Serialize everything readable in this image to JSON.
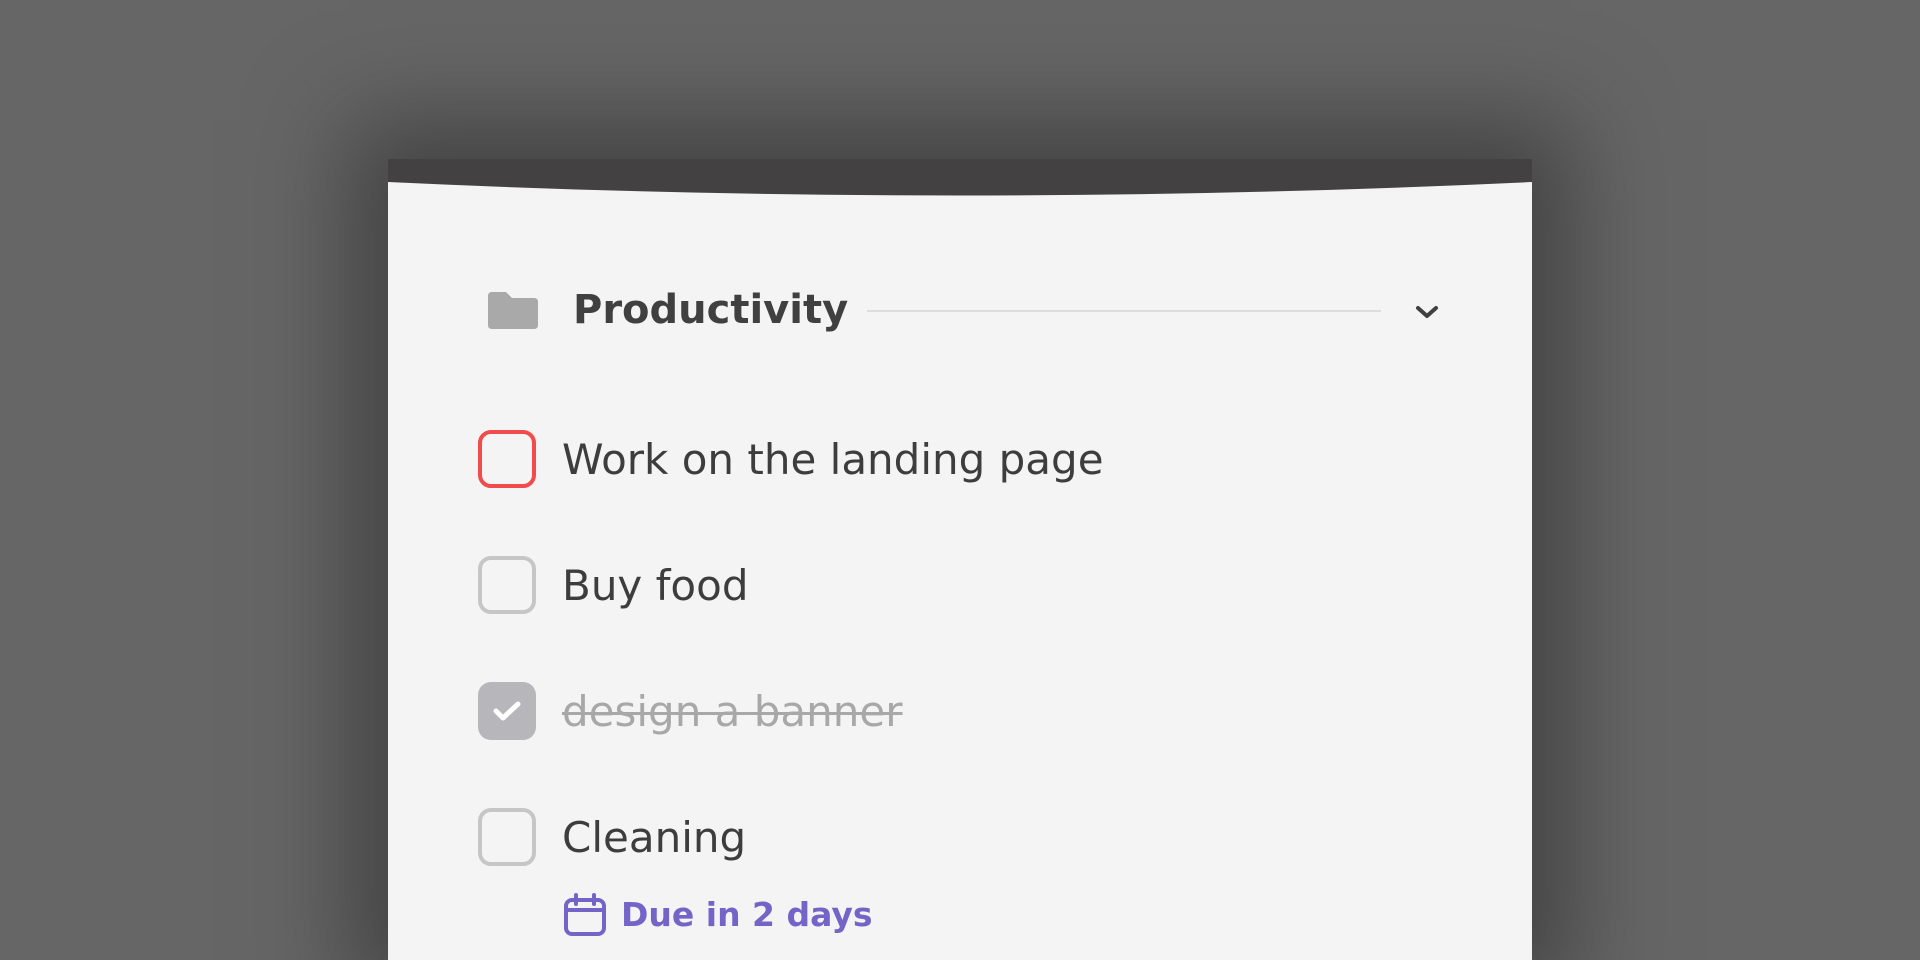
{
  "group": {
    "title": "Productivity",
    "icon": "folder-icon",
    "collapse_icon": "chevron-down-icon"
  },
  "tasks": [
    {
      "label": "Work on the landing page",
      "state": "unchecked",
      "priority": "high"
    },
    {
      "label": "Buy food",
      "state": "unchecked",
      "priority": "none"
    },
    {
      "label": "design a banner",
      "state": "checked",
      "priority": "none"
    },
    {
      "label": "Cleaning",
      "state": "unchecked",
      "priority": "none",
      "due": "Due in 2 days",
      "due_icon": "calendar-icon"
    }
  ],
  "colors": {
    "background": "#666666",
    "card": "#f4f4f4",
    "card_top": "#434142",
    "priority": "#f24b4b",
    "due": "#7464c8",
    "checked": "#b7b7bb"
  }
}
